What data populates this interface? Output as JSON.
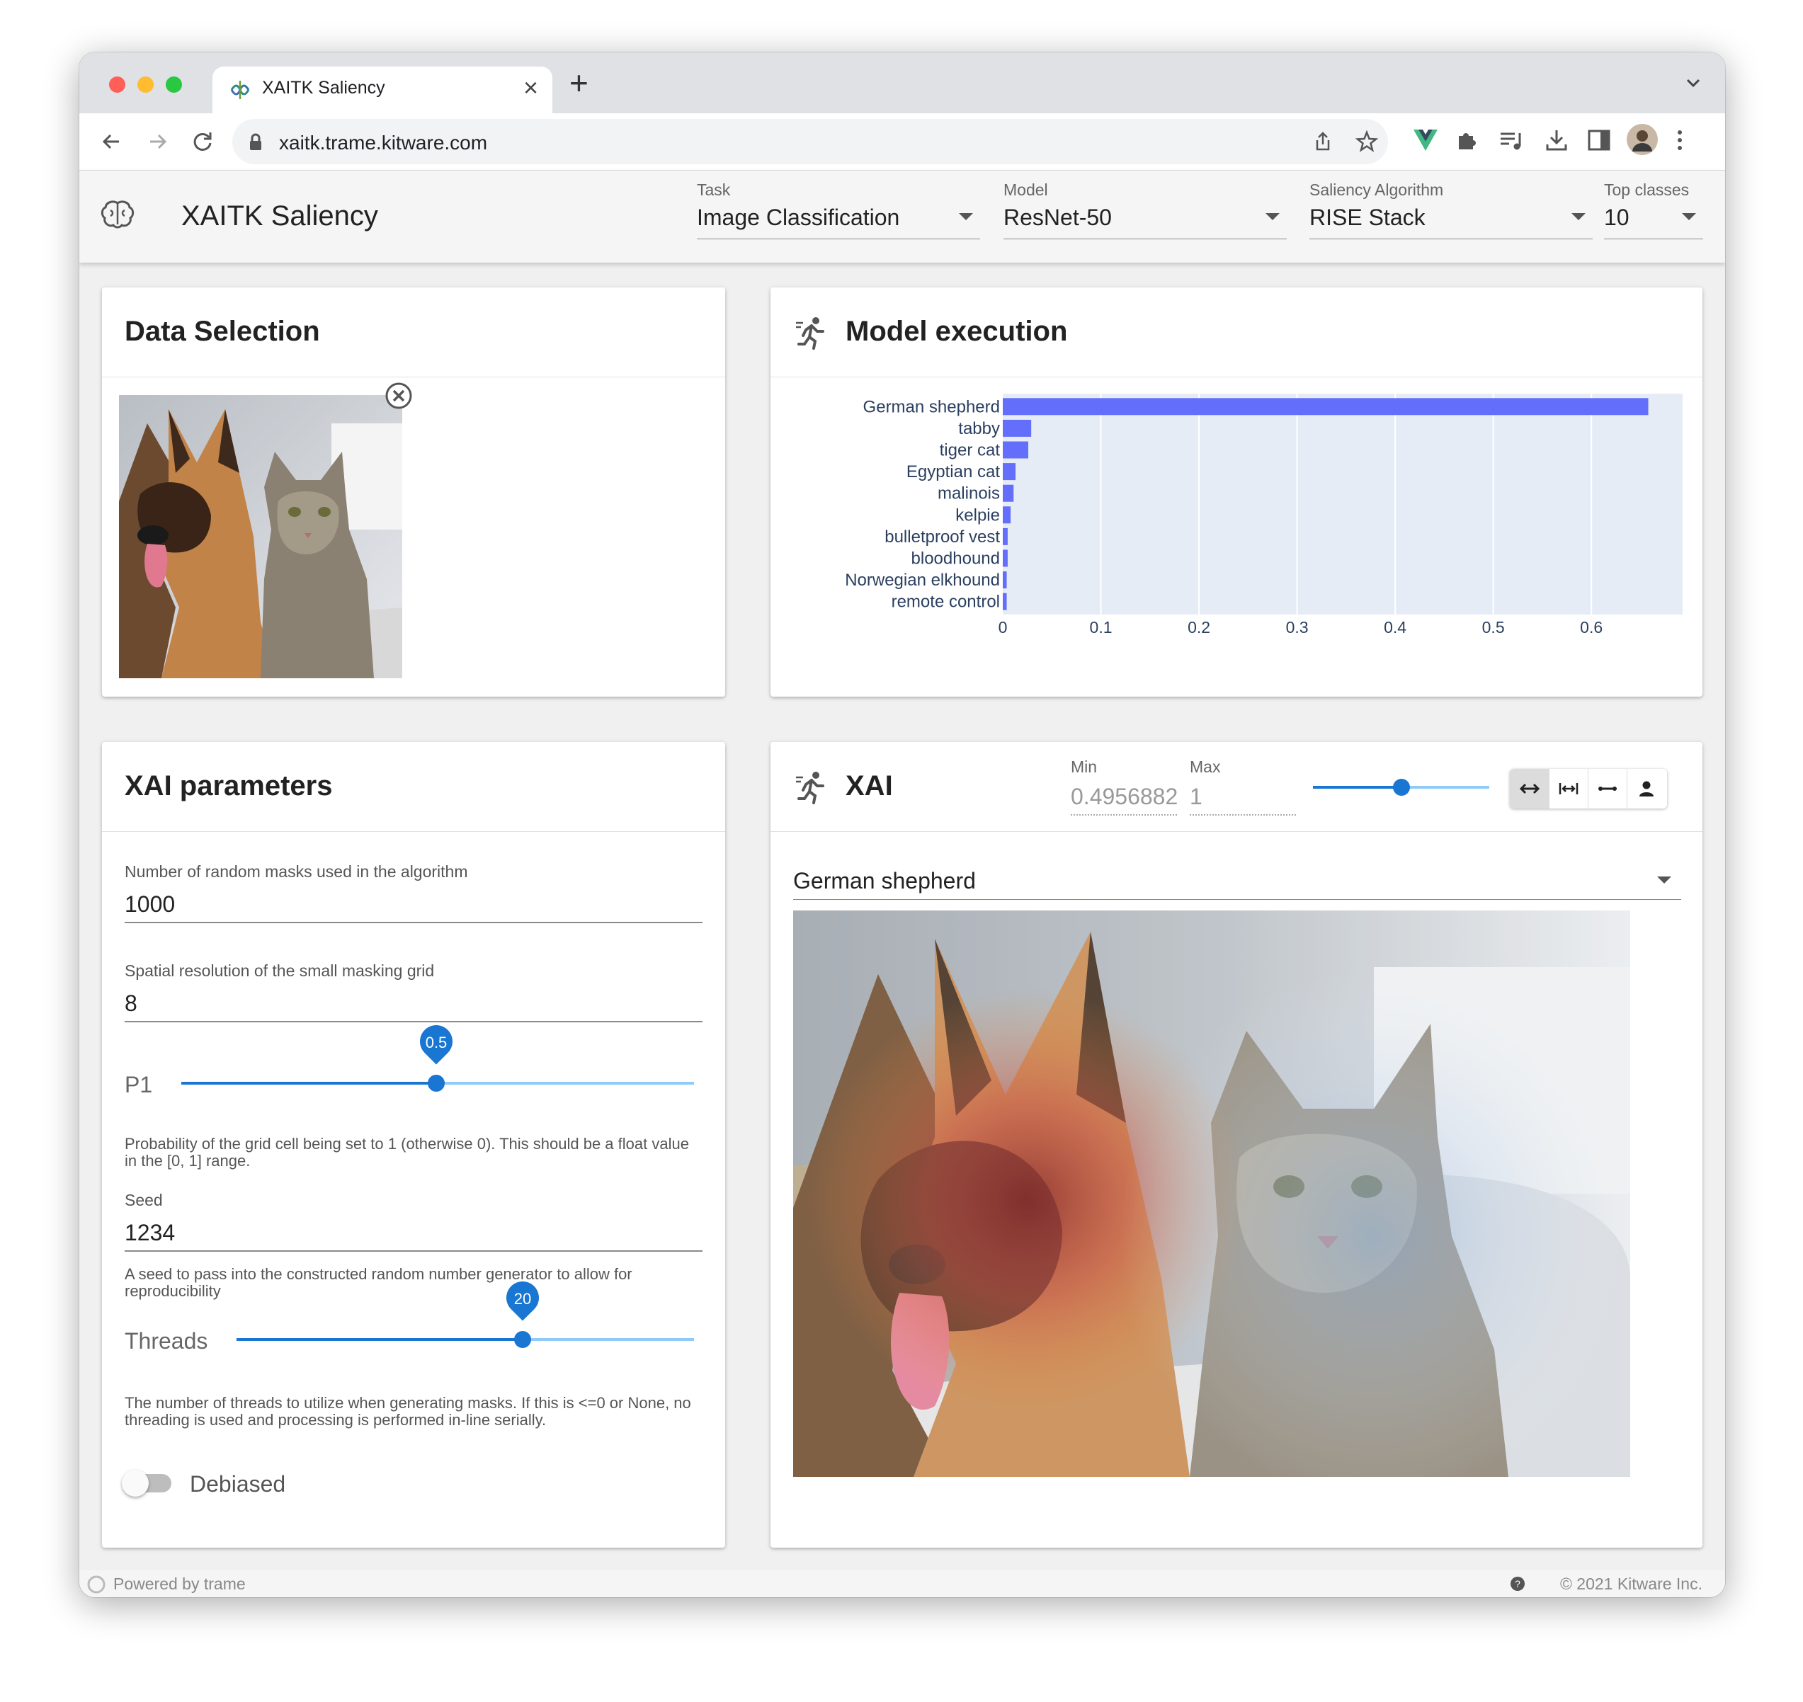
{
  "browser": {
    "tab_title": "XAITK Saliency",
    "url": "xaitk.trame.kitware.com",
    "traffic_lights": {
      "close": "#ff5f57",
      "minimize": "#febc2e",
      "zoom": "#28c840"
    }
  },
  "appbar": {
    "title": "XAITK Saliency",
    "logo_icon": "brain-icon",
    "selects": [
      {
        "label": "Task",
        "value": "Image Classification"
      },
      {
        "label": "Model",
        "value": "ResNet-50"
      },
      {
        "label": "Saliency Algorithm",
        "value": "RISE Stack"
      },
      {
        "label": "Top classes",
        "value": "10"
      }
    ]
  },
  "data_selection": {
    "title": "Data Selection",
    "image_alt": "German shepherd and tabby cat photo"
  },
  "model_execution": {
    "title": "Model execution",
    "icon": "running-person-icon"
  },
  "chart_data": {
    "type": "bar",
    "orientation": "horizontal",
    "categories": [
      "German shepherd",
      "tabby",
      "tiger cat",
      "Egyptian cat",
      "malinois",
      "kelpie",
      "bulletproof vest",
      "bloodhound",
      "Norwegian elkhound",
      "remote control"
    ],
    "values": [
      0.658,
      0.029,
      0.026,
      0.013,
      0.011,
      0.008,
      0.005,
      0.005,
      0.004,
      0.004
    ],
    "xlim": [
      0,
      0.693
    ],
    "xticks": [
      "0",
      "0.1",
      "0.2",
      "0.3",
      "0.4",
      "0.5",
      "0.6"
    ],
    "xtick_values": [
      0,
      0.1,
      0.2,
      0.3,
      0.4,
      0.5,
      0.6
    ],
    "grid": true,
    "bar_color": "#636efa",
    "plot_bg": "#e5ecf6"
  },
  "xai_params": {
    "title": "XAI parameters",
    "masks": {
      "label": "Number of random masks used in the algorithm",
      "value": "1000"
    },
    "grid": {
      "label": "Spatial resolution of the small masking grid",
      "value": "8"
    },
    "p1": {
      "label": "P1",
      "value": "0.5",
      "fraction": 0.5,
      "hint": "Probability of the grid cell being set to 1 (otherwise 0). This should be a float value in the [0, 1] range."
    },
    "seed": {
      "label": "Seed",
      "value": "1234",
      "hint": "A seed to pass into the constructed random number generator to allow for reproducibility"
    },
    "threads": {
      "label": "Threads",
      "value": "20",
      "fraction": 0.625,
      "hint": "The number of threads to utilize when generating masks. If this is <=0 or None, no threading is used and processing is performed in-line serially."
    },
    "debiased": {
      "label": "Debiased",
      "checked": false
    }
  },
  "xai": {
    "title": "XAI",
    "icon": "running-person-icon",
    "min_label": "Min",
    "min_value": "0.4956882",
    "max_label": "Max",
    "max_value": "1",
    "opacity_fraction": 0.5,
    "buttons": [
      "expand-horizontal-icon",
      "fit-width-icon",
      "arrow-horizontal-icon",
      "person-icon"
    ],
    "class_select": "German shepherd"
  },
  "footer": {
    "powered_by": "Powered by trame",
    "copyright": "© 2021 Kitware Inc."
  }
}
